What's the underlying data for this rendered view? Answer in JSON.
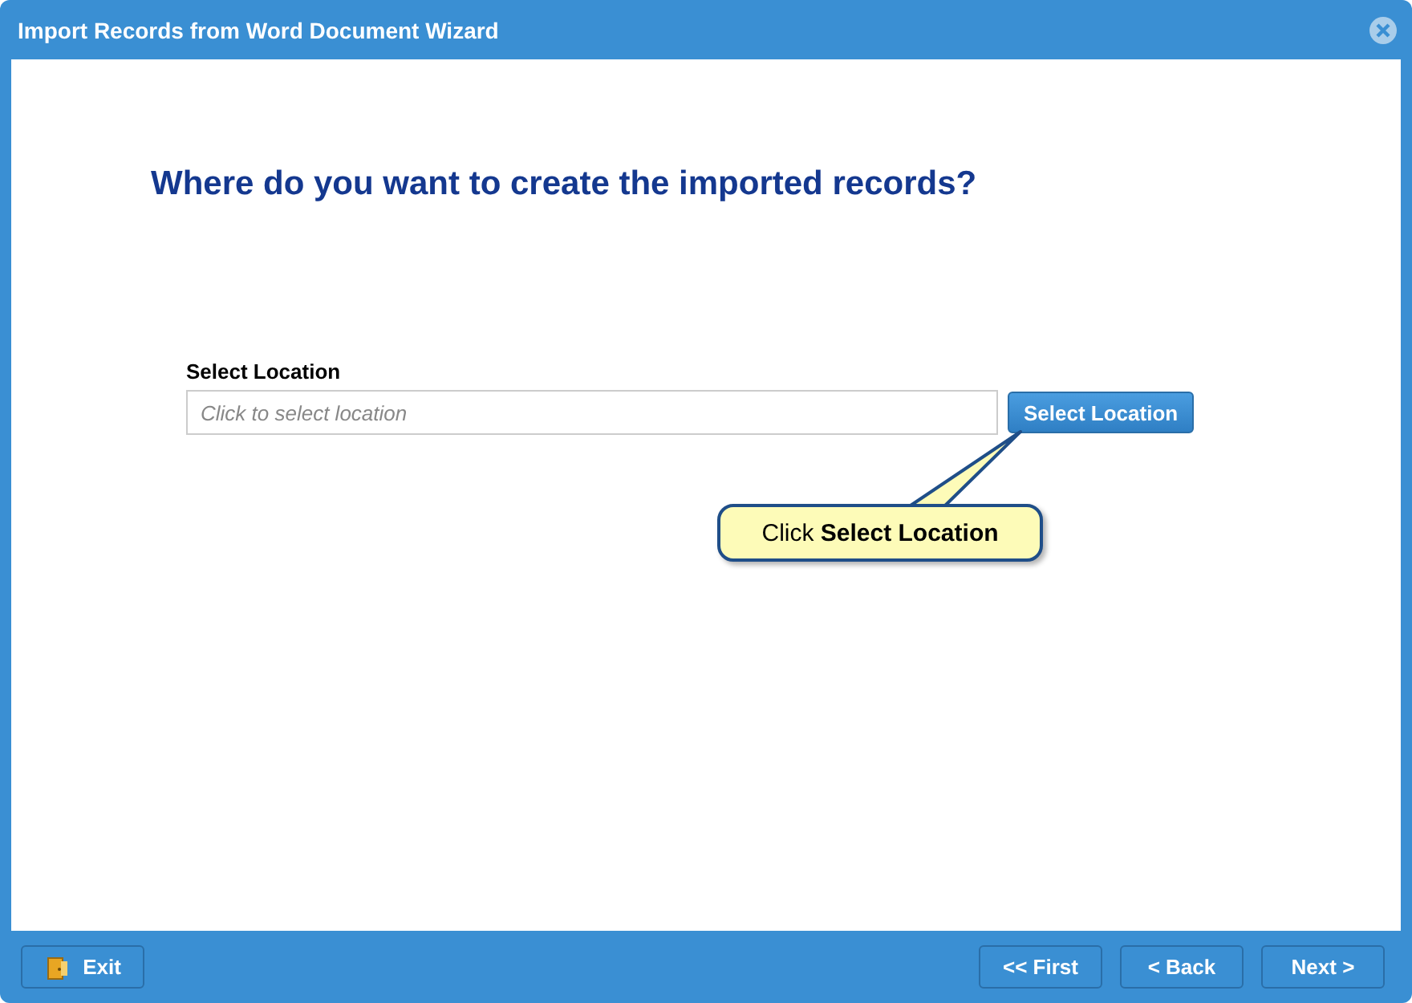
{
  "window": {
    "title": "Import Records from Word Document Wizard"
  },
  "heading": "Where do you want to create the imported records?",
  "location": {
    "label": "Select Location",
    "placeholder": "Click to select location",
    "button": "Select Location"
  },
  "callout": "Click **Select Location**",
  "footer": {
    "left": [
      {
        "label": "Exit",
        "kind": "exit"
      }
    ],
    "right": [
      {
        "label": "<< First",
        "kind": "plain"
      },
      {
        "label": "< Back",
        "kind": "plain"
      },
      {
        "label": "Next >",
        "kind": "plain"
      }
    ]
  }
}
